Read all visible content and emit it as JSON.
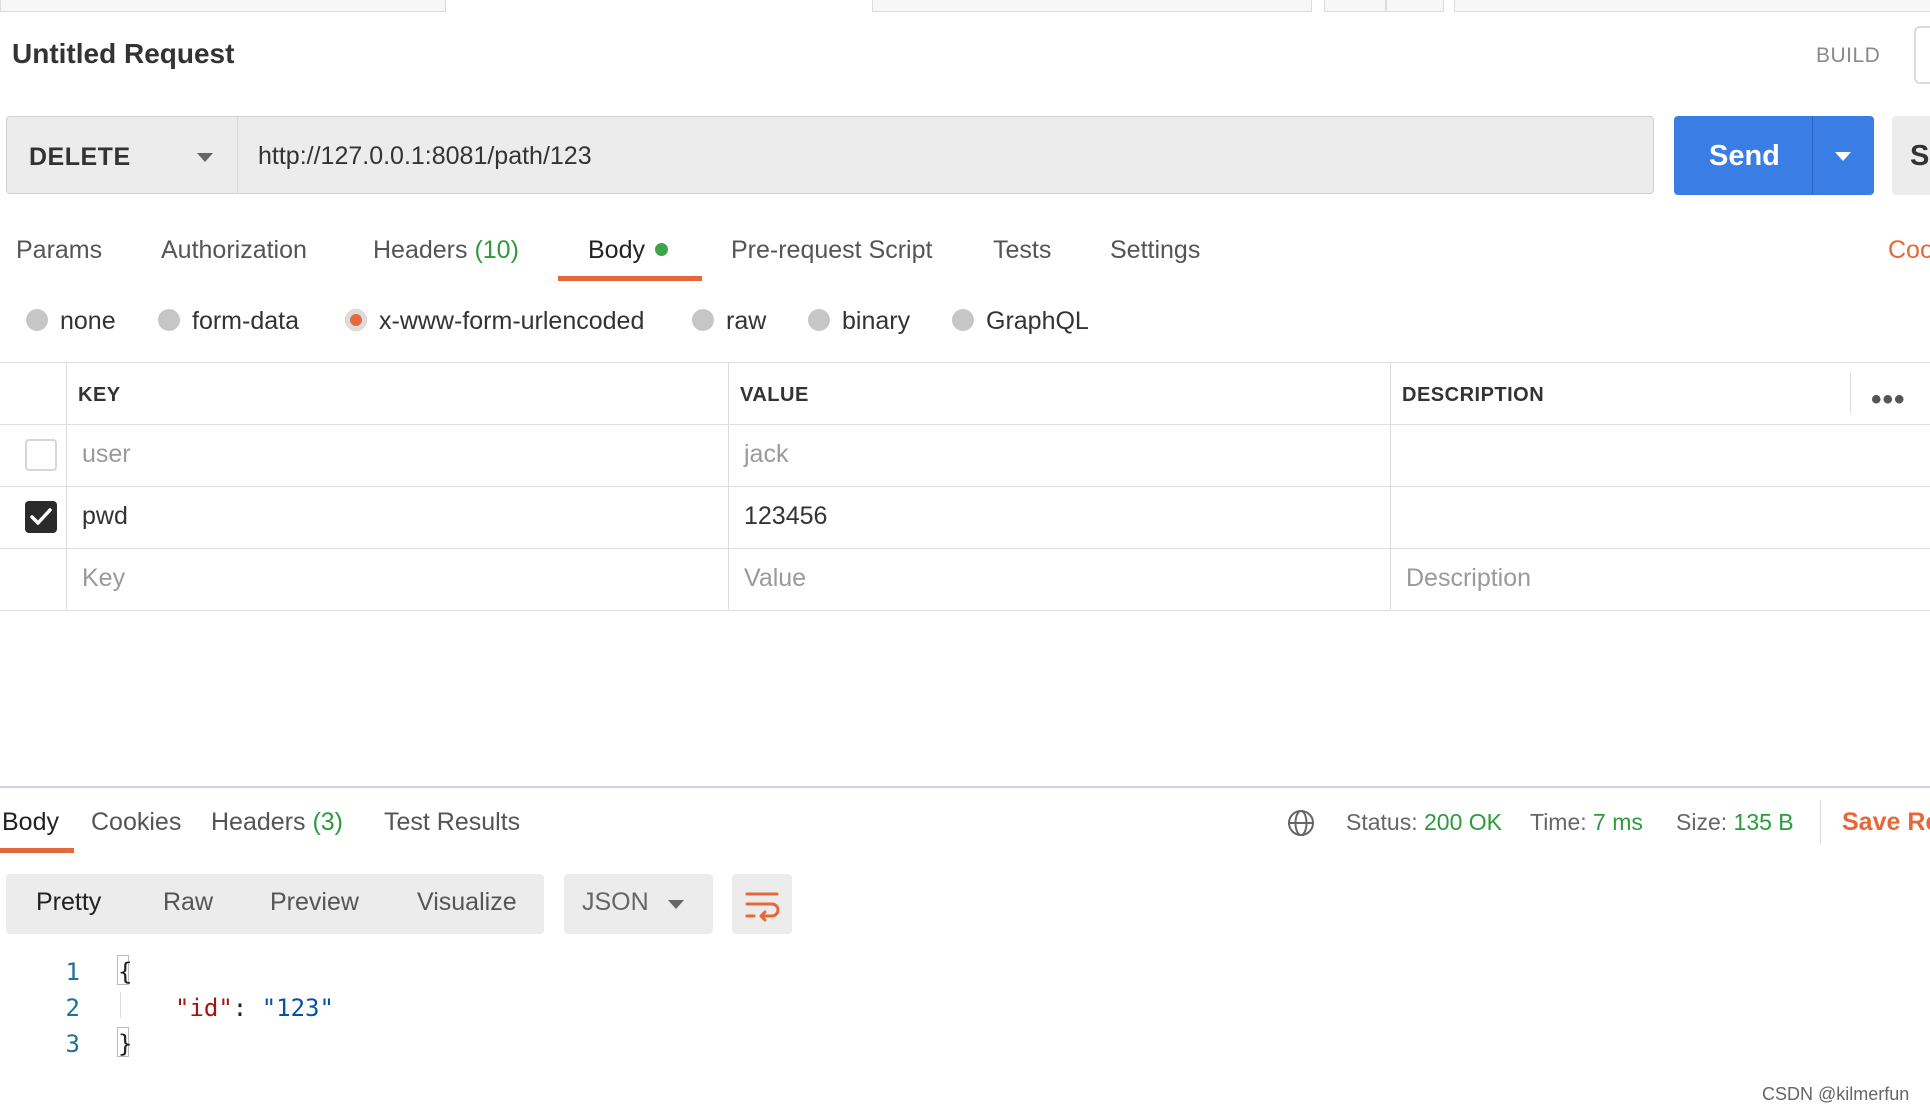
{
  "request": {
    "title": "Untitled Request",
    "build_label": "BUILD",
    "method": "DELETE",
    "url": "http://127.0.0.1:8081/path/123",
    "send_label": "Send",
    "save_label_partial": "Sa"
  },
  "request_tabs": {
    "params": "Params",
    "authorization": "Authorization",
    "headers": "Headers",
    "headers_count": "(10)",
    "body": "Body",
    "prerequest": "Pre-request Script",
    "tests": "Tests",
    "settings": "Settings",
    "cookies_partial": "Coo"
  },
  "body_types": {
    "none": "none",
    "form_data": "form-data",
    "urlencoded": "x-www-form-urlencoded",
    "raw": "raw",
    "binary": "binary",
    "graphql": "GraphQL",
    "selected": "x-www-form-urlencoded"
  },
  "params_table": {
    "headers": {
      "key": "KEY",
      "value": "VALUE",
      "description": "DESCRIPTION"
    },
    "rows": [
      {
        "checked": false,
        "key": "user",
        "value": "jack",
        "description": ""
      },
      {
        "checked": true,
        "key": "pwd",
        "value": "123456",
        "description": ""
      }
    ],
    "placeholders": {
      "key": "Key",
      "value": "Value",
      "description": "Description"
    }
  },
  "response": {
    "tabs": {
      "body": "Body",
      "cookies": "Cookies",
      "headers": "Headers",
      "headers_count": "(3)",
      "test_results": "Test Results"
    },
    "status_label": "Status:",
    "status_value": "200 OK",
    "time_label": "Time:",
    "time_value": "7 ms",
    "size_label": "Size:",
    "size_value": "135 B",
    "save_partial": "Save Re",
    "view_modes": {
      "pretty": "Pretty",
      "raw": "Raw",
      "preview": "Preview",
      "visualize": "Visualize"
    },
    "format": "JSON",
    "code_lines": [
      {
        "num": "1",
        "text": "{"
      },
      {
        "num": "2",
        "key": "\"id\"",
        "sep": ": ",
        "value": "\"123\""
      },
      {
        "num": "3",
        "text": "}"
      }
    ]
  },
  "watermark": "CSDN @kilmerfun",
  "colors": {
    "accent": "#e5683a",
    "send_blue": "#3a7de4",
    "success_green": "#2d9a3c"
  }
}
